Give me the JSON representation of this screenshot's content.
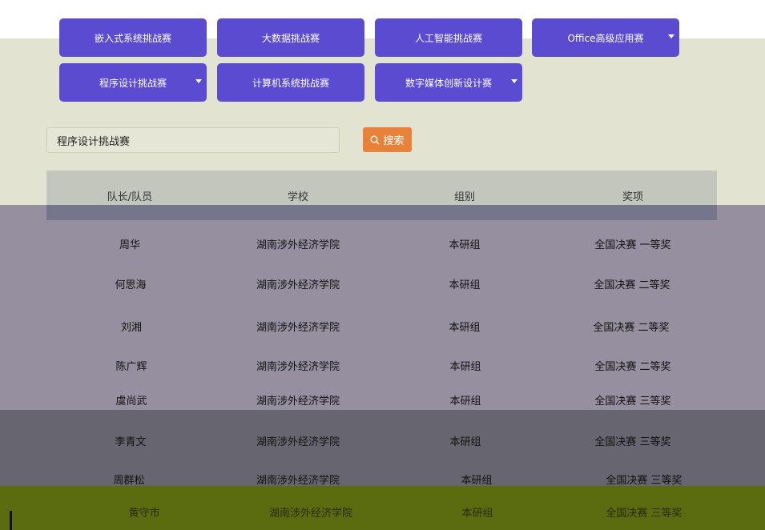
{
  "categories": [
    {
      "label": "嵌入式系统挑战赛",
      "dropdown": false
    },
    {
      "label": "大数据挑战赛",
      "dropdown": false
    },
    {
      "label": "人工智能挑战赛",
      "dropdown": false
    },
    {
      "label": "Office高级应用赛",
      "dropdown": true
    },
    {
      "label": "程序设计挑战赛",
      "dropdown": true
    },
    {
      "label": "计算机系统挑战赛",
      "dropdown": false
    },
    {
      "label": "数字媒体创新设计赛",
      "dropdown": true
    }
  ],
  "search": {
    "value": "程序设计挑战赛",
    "button_label": "搜索"
  },
  "table": {
    "headers": [
      "队长/队员",
      "学校",
      "组别",
      "奖项"
    ],
    "rows": [
      [
        "周华",
        "湖南涉外经济学院",
        "本研组",
        "全国决赛 一等奖"
      ],
      [
        "何思海",
        "湖南涉外经济学院",
        "本研组",
        "全国决赛 二等奖"
      ],
      [
        "刘湘",
        "湖南涉外经济学院",
        "本研组",
        "全国决赛 二等奖"
      ],
      [
        "陈广辉",
        "湖南涉外经济学院",
        "本研组",
        "全国决赛 二等奖"
      ],
      [
        "虞尚武",
        "湖南涉外经济学院",
        "本研组",
        "全国决赛 三等奖"
      ],
      [
        "李青文",
        "湖南涉外经济学院",
        "本研组",
        "全国决赛 三等奖"
      ],
      [
        "周群松",
        "湖南涉外经济学院",
        "本研组",
        "全国决赛 三等奖"
      ],
      [
        "黄守市",
        "湖南涉外经济学院",
        "本研组",
        "全国决赛 三等奖"
      ]
    ]
  },
  "colors": {
    "category_button": "#5b4bd1",
    "search_button": "#e8823a"
  }
}
